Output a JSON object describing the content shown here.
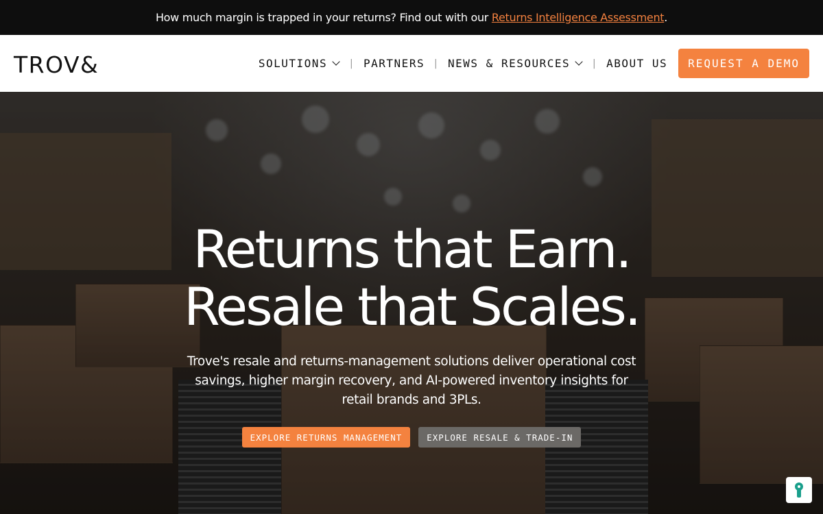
{
  "announcement": {
    "text": "How much margin is trapped in your returns? Find out with our ",
    "link_label": "Returns Intelligence Assessment",
    "suffix": "."
  },
  "header": {
    "logo": "TROV&",
    "nav": [
      {
        "label": "SOLUTIONS",
        "has_dropdown": true
      },
      {
        "label": "PARTNERS",
        "has_dropdown": false
      },
      {
        "label": "NEWS & RESOURCES",
        "has_dropdown": true
      },
      {
        "label": "ABOUT US",
        "has_dropdown": false
      }
    ],
    "demo_label": "REQUEST A DEMO"
  },
  "hero": {
    "headline_line1": "Returns that Earn.",
    "headline_line2": "Resale that Scales.",
    "subtext": "Trove's resale and returns-management solutions deliver operational cost savings, higher margin recovery, and AI-powered inventory insights for retail brands and 3PLs.",
    "cta_primary": "EXPLORE RETURNS MANAGEMENT",
    "cta_secondary": "EXPLORE RESALE & TRADE-IN"
  },
  "colors": {
    "accent": "#f4823f",
    "announcement_bg": "#0e0e0e",
    "secondary_button": "#6b6966",
    "privacy_icon": "#1a9f8c"
  },
  "icons": {
    "privacy_widget": "keyhole-icon",
    "dropdown": "chevron-down-icon"
  }
}
